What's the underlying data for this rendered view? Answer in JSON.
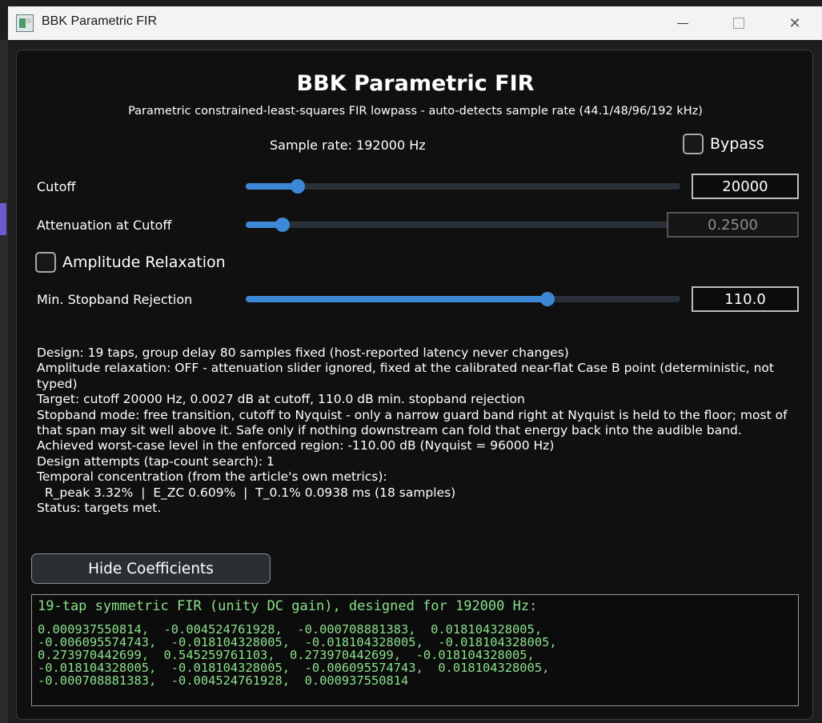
{
  "window": {
    "title": "BBK Parametric FIR",
    "icons": {
      "app": "fir-app-icon",
      "minimize": "minimize-icon",
      "maximize": "maximize-icon",
      "close": "close-icon"
    }
  },
  "header": {
    "title": "BBK Parametric FIR",
    "subtitle": "Parametric constrained-least-squares FIR lowpass - auto-detects sample rate (44.1/48/96/192 kHz)",
    "sample_rate": "Sample rate: 192000 Hz"
  },
  "bypass": {
    "label": "Bypass",
    "checked": false
  },
  "controls": {
    "cutoff": {
      "label": "Cutoff",
      "value": "20000",
      "fraction": 0.12
    },
    "attenuation": {
      "label": "Attenuation at Cutoff",
      "value": "0.2500",
      "fraction": 0.085,
      "disabled": true
    },
    "relaxation": {
      "label": "Amplitude Relaxation",
      "checked": false
    },
    "stopband": {
      "label": "Min. Stopband Rejection",
      "value": "110.0",
      "fraction": 0.695
    }
  },
  "status_lines": [
    "Design: 19 taps, group delay 80 samples fixed (host-reported latency never changes)",
    "Amplitude relaxation: OFF - attenuation slider ignored, fixed at the calibrated near-flat Case B point (deterministic, not typed)",
    "Target: cutoff 20000 Hz, 0.0027 dB at cutoff, 110.0 dB min. stopband rejection",
    "Stopband mode: free transition, cutoff to Nyquist - only a narrow guard band right at Nyquist is held to the floor; most of that span may sit well above it. Safe only if nothing downstream can fold that energy back into the audible band.",
    "Achieved worst-case level in the enforced region: -110.00 dB (Nyquist = 96000 Hz)",
    "Design attempts (tap-count search): 1",
    "Temporal concentration (from the article's own metrics):",
    "  R_peak 3.32%  |  E_ZC 0.609%  |  T_0.1% 0.0938 ms (18 samples)",
    "Status: targets met."
  ],
  "coefficients": {
    "button_label": "Hide Coefficients",
    "header": "19-tap symmetric FIR (unity DC gain), designed for 192000 Hz:",
    "lines": [
      "0.000937550814,  -0.004524761928,  -0.000708881383,  0.018104328005,",
      "-0.006095574743,  -0.018104328005,  -0.018104328005,  -0.018104328005,",
      "0.273970442699,  0.545259761103,  0.273970442699,  -0.018104328005,",
      "-0.018104328005,  -0.018104328005,  -0.006095574743,  0.018104328005,",
      "-0.000708881383,  -0.004524761928,  0.000937550814"
    ]
  }
}
